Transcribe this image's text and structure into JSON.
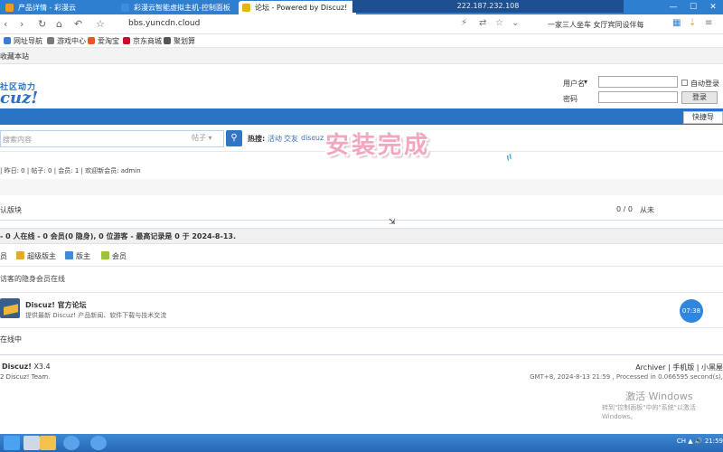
{
  "browser": {
    "tabs": [
      {
        "title": "产品详情 - 彩漫云",
        "color": "#f39c1f"
      },
      {
        "title": "彩漫云智能虚拟主机-控制面板",
        "color": "#3c8de0"
      },
      {
        "title": "论坛 - Powered by Discuz!",
        "color": "#e8b21a"
      }
    ],
    "remote_ip": "222.187.232.108",
    "window_controls": [
      "—",
      "☐",
      "✕"
    ],
    "url": "bbs.yuncdn.cloud",
    "search_text": "一家三人坐车 女厅宾同设伴每",
    "bookmarks": [
      {
        "label": "网址导航",
        "color": "#3a7bd5"
      },
      {
        "label": "游戏中心",
        "color": "#7a7a7a"
      },
      {
        "label": "爱淘宝",
        "color": "#e8572b"
      },
      {
        "label": "京东商城",
        "color": "#c8102e"
      },
      {
        "label": "聚划算",
        "color": "#555555"
      }
    ]
  },
  "page": {
    "set_home": "收藏本站",
    "logo_tagline": "社区动力",
    "logo_text": "cuz!",
    "login": {
      "username_label": "用户名",
      "password_label": "密码",
      "remember_label": "自动登录",
      "login_button": "登录"
    },
    "quick_nav": "快捷导",
    "search": {
      "placeholder": "搜索内容",
      "type": "帖子",
      "hot_label": "热搜:",
      "hot_items": [
        "活动",
        "交友",
        "discuz"
      ]
    },
    "banner": "安装完成",
    "stats": "| 昨日: 0 | 帖子: 0 | 会员: 1 | 欢迎新会员: admin",
    "section": {
      "title": "认版块",
      "count": "0 / 0",
      "extra": "从未"
    },
    "online_summary": "- 0 人在线 - 0 会员(0 隐身), 0 位游客 - 最高记录是 0 于 2024-8-13.",
    "roles": [
      {
        "label": "超级版主",
        "color": "#e8a735"
      },
      {
        "label": "版主",
        "color": "#3f8bd8"
      },
      {
        "label": "会员",
        "color": "#9cc23a"
      }
    ],
    "roles_prefix": "员",
    "hidden_note": "访客的隐身会员在线",
    "forum": {
      "name": "Discuz! 官方论坛",
      "desc": "提供最新 Discuz! 产品新闻、软件下载与技术交流"
    },
    "timer": "07:38",
    "online_link": "在线中",
    "footer": {
      "brand": "Discuz!",
      "version": "X3.4",
      "team": "2 Discuz! Team.",
      "links": "Archiver | 手机版 | 小黑屋",
      "time": "GMT+8, 2024-8-13 21:59 , Processed in 0.066595 second(s),"
    },
    "activate": "激活 Windows",
    "activate_sub": "转到\"控制面板\"中的\"系统\"以激活 Windows。"
  },
  "taskbar": {
    "items": [
      "start",
      "server-manager",
      "explorer",
      "browser",
      "browser2"
    ],
    "tray": "CH ▲ 🔊 21:59"
  }
}
